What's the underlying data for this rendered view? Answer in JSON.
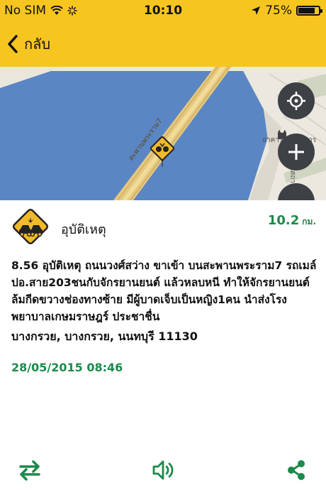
{
  "status_bar": {
    "carrier": "No SIM",
    "time": "10:10",
    "battery": "75%",
    "battery_level": 0.75
  },
  "nav": {
    "back_label": "กลับ"
  },
  "map": {
    "road_label": "สะพานพระราม7",
    "poi_label": "อาคารอำนวยการ",
    "poi_label_2": "นายสถาน"
  },
  "incident": {
    "title": "อุบัติเหตุ",
    "distance_value": "10.2",
    "distance_unit": "กม.",
    "description": "8.56 อุบัติเหตุ ถนนวงศ์สว่าง ขาเข้า บนสะพานพระราม7 รถเมล์ ปอ.สาย203ชนกับจักรยานยนต์ แล้วหลบหนี ทำให้จักรยานยนต์ ล้มกีดขวางช่องทางซ้าย มีผู้บาดเจ็บเป็นหญิง1คน  นำส่งโรงพยาบาลเกษมราษฎร์ ประชาชื่น",
    "address": "บางกรวย, บางกรวย, นนทบุรี 11130",
    "datetime": "28/05/2015   08:46"
  },
  "colors": {
    "accent_yellow": "#f7c520",
    "accent_green": "#1c8a4a",
    "map_water": "#5b86c4",
    "map_button": "#3d4145"
  },
  "icons": {
    "back": "chevron-left-icon",
    "locate": "crosshair-icon",
    "zoom_in": "plus-icon",
    "swap": "swap-arrows-icon",
    "speaker": "speaker-icon",
    "share": "share-icon"
  }
}
